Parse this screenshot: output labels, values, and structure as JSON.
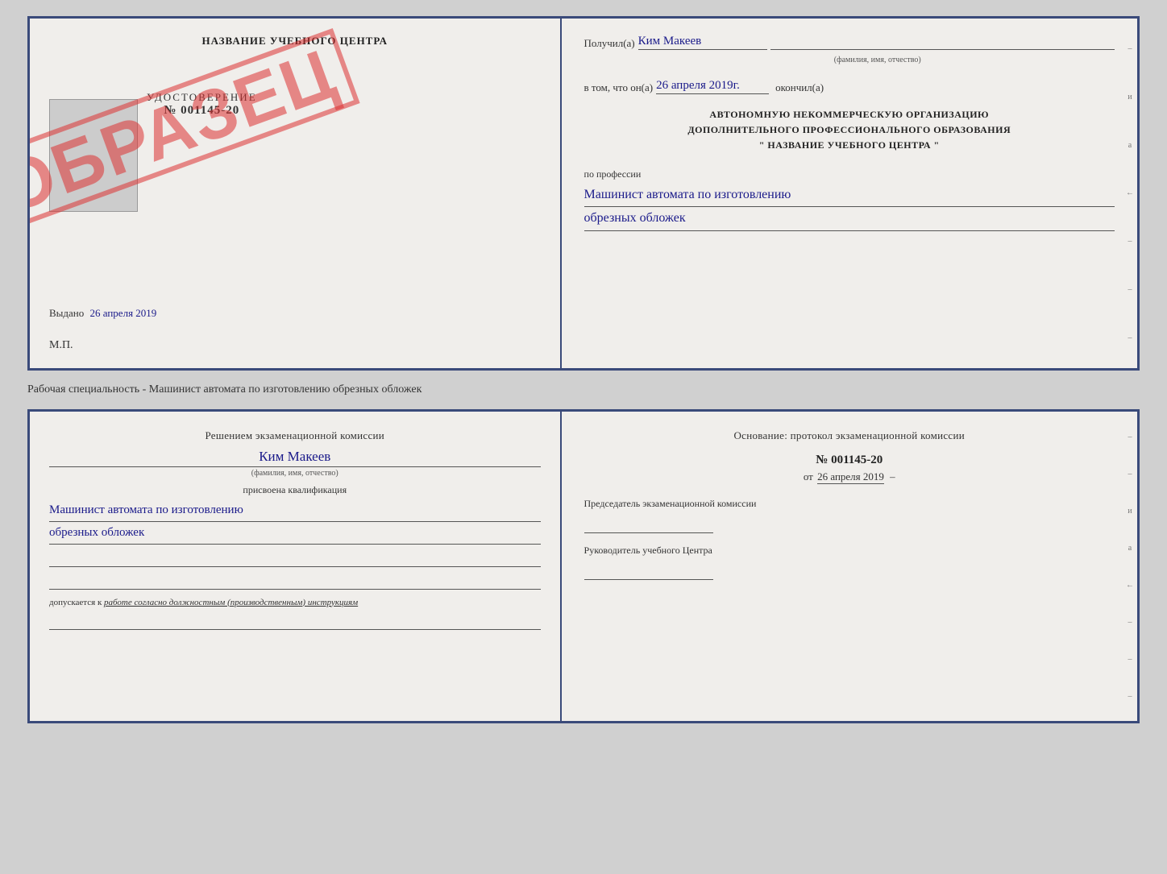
{
  "page": {
    "background": "#d0d0d0"
  },
  "top_document": {
    "left": {
      "institution_title": "НАЗВАНИЕ УЧЕБНОГО ЦЕНТРА",
      "cert_word": "УДОСТОВЕРЕНИЕ",
      "cert_number": "№ 001145-20",
      "issued_label": "Выдано",
      "issued_date": "26 апреля 2019",
      "mp_label": "М.П.",
      "stamp_text": "ОБРАЗЕЦ"
    },
    "right": {
      "received_label": "Получил(а)",
      "received_value": "Ким Макеев",
      "received_sub": "(фамилия, имя, отчество)",
      "date_prefix": "в том, что он(а)",
      "date_value": "26 апреля 2019г.",
      "date_suffix": "окончил(а)",
      "org_line1": "АВТОНОМНУЮ НЕКОММЕРЧЕСКУЮ ОРГАНИЗАЦИЮ",
      "org_line2": "ДОПОЛНИТЕЛЬНОГО ПРОФЕССИОНАЛЬНОГО ОБРАЗОВАНИЯ",
      "org_line3": "\" НАЗВАНИЕ УЧЕБНОГО ЦЕНТРА \"",
      "profession_label": "по профессии",
      "profession_line1": "Машинист автомата по изготовлению",
      "profession_line2": "обрезных обложек"
    }
  },
  "separator": {
    "text": "Рабочая специальность - Машинист автомата по изготовлению обрезных обложек"
  },
  "bottom_document": {
    "left": {
      "decision_text": "Решением экзаменационной комиссии",
      "name_value": "Ким Макеев",
      "name_sub": "(фамилия, имя, отчество)",
      "qual_label": "присвоена квалификация",
      "qual_line1": "Машинист автомата по изготовлению",
      "qual_line2": "обрезных обложек",
      "admit_label": "допускается к",
      "admit_italic": "работе согласно должностным (производственным) инструкциям"
    },
    "right": {
      "basis_text": "Основание: протокол экзаменационной комиссии",
      "protocol_number": "№ 001145-20",
      "protocol_date_prefix": "от",
      "protocol_date": "26 апреля 2019",
      "chair_label": "Председатель экзаменационной комиссии",
      "head_label": "Руководитель учебного Центра"
    }
  },
  "right_side_chars": [
    "и",
    "а",
    "←",
    "–",
    "–",
    "–",
    "–"
  ],
  "right_side_chars2": [
    "и",
    "а",
    "←",
    "–",
    "–",
    "–",
    "–"
  ]
}
